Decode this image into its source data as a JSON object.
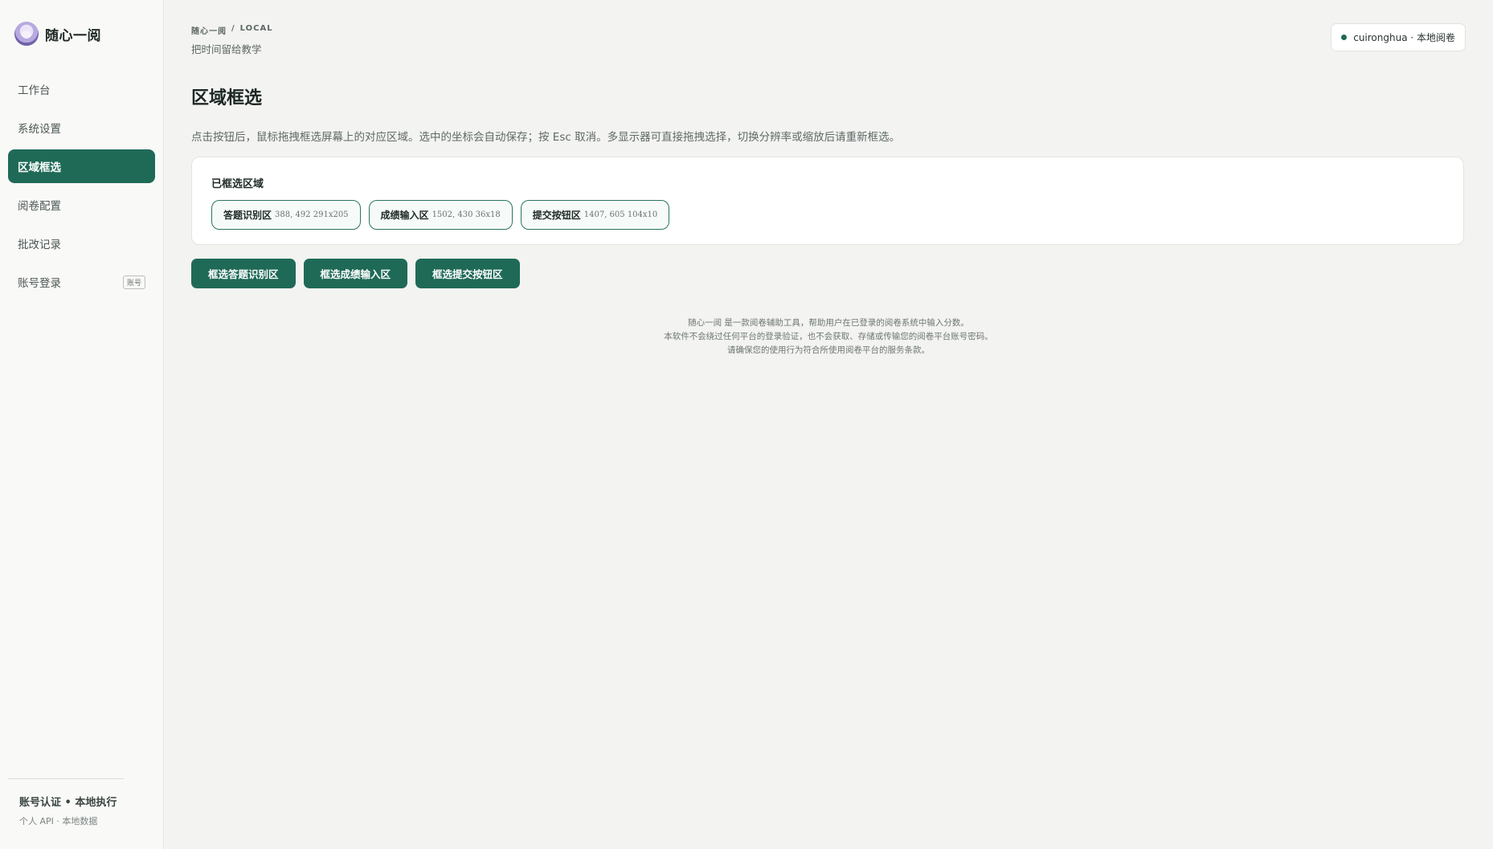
{
  "app": {
    "title": "随心一阅"
  },
  "sidebar": {
    "items": [
      {
        "label": "工作台"
      },
      {
        "label": "系统设置"
      },
      {
        "label": "区域框选",
        "active": true
      },
      {
        "label": "阅卷配置"
      },
      {
        "label": "批改记录"
      },
      {
        "label": "账号登录",
        "badge": "账号"
      }
    ],
    "footer": {
      "title": "账号认证 • 本地执行",
      "subtitle": "个人 API · 本地数据"
    }
  },
  "header": {
    "breadcrumb": [
      "随心一阅",
      "/",
      "LOCAL"
    ],
    "subtitle": "把时间留给教学",
    "user_status": "cuironghua · 本地阅卷"
  },
  "main": {
    "title": "区域框选",
    "description": "点击按钮后，鼠标拖拽框选屏幕上的对应区域。选中的坐标会自动保存；按 Esc 取消。多显示器可直接拖拽选择，切换分辨率或缩放后请重新框选。",
    "selected_card": {
      "title": "已框选区域",
      "regions": [
        {
          "label": "答题识别区",
          "coords": "388, 492  291x205"
        },
        {
          "label": "成绩输入区",
          "coords": "1502, 430  36x18"
        },
        {
          "label": "提交按钮区",
          "coords": "1407, 605  104x10"
        }
      ]
    },
    "actions": [
      {
        "label": "框选答题识别区"
      },
      {
        "label": "框选成绩输入区"
      },
      {
        "label": "框选提交按钮区"
      }
    ],
    "disclaimer": [
      "随心一阅 是一款阅卷辅助工具，帮助用户在已登录的阅卷系统中输入分数。",
      "本软件不会绕过任何平台的登录验证，也不会获取、存储或传输您的阅卷平台账号密码。",
      "请确保您的使用行为符合所使用阅卷平台的服务条款。"
    ]
  },
  "colors": {
    "accent": "#1f6a57",
    "background": "#f3f3f1",
    "sidebar_bg": "#f9f9f7"
  }
}
